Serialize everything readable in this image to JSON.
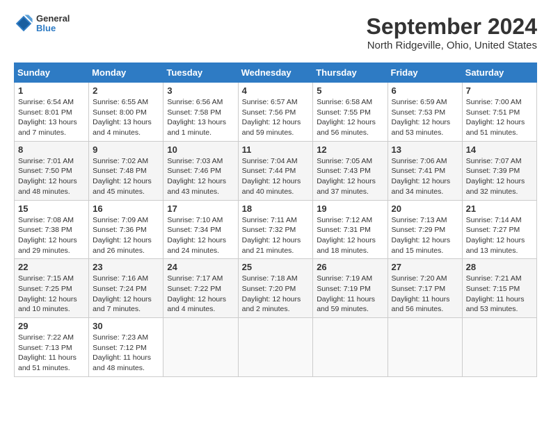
{
  "app": {
    "logo_line1": "General",
    "logo_line2": "Blue"
  },
  "header": {
    "title": "September 2024",
    "subtitle": "North Ridgeville, Ohio, United States"
  },
  "calendar": {
    "days_of_week": [
      "Sunday",
      "Monday",
      "Tuesday",
      "Wednesday",
      "Thursday",
      "Friday",
      "Saturday"
    ],
    "weeks": [
      [
        {
          "day": 1,
          "info": "Sunrise: 6:54 AM\nSunset: 8:01 PM\nDaylight: 13 hours and 7 minutes."
        },
        {
          "day": 2,
          "info": "Sunrise: 6:55 AM\nSunset: 8:00 PM\nDaylight: 13 hours and 4 minutes."
        },
        {
          "day": 3,
          "info": "Sunrise: 6:56 AM\nSunset: 7:58 PM\nDaylight: 13 hours and 1 minute."
        },
        {
          "day": 4,
          "info": "Sunrise: 6:57 AM\nSunset: 7:56 PM\nDaylight: 12 hours and 59 minutes."
        },
        {
          "day": 5,
          "info": "Sunrise: 6:58 AM\nSunset: 7:55 PM\nDaylight: 12 hours and 56 minutes."
        },
        {
          "day": 6,
          "info": "Sunrise: 6:59 AM\nSunset: 7:53 PM\nDaylight: 12 hours and 53 minutes."
        },
        {
          "day": 7,
          "info": "Sunrise: 7:00 AM\nSunset: 7:51 PM\nDaylight: 12 hours and 51 minutes."
        }
      ],
      [
        {
          "day": 8,
          "info": "Sunrise: 7:01 AM\nSunset: 7:50 PM\nDaylight: 12 hours and 48 minutes."
        },
        {
          "day": 9,
          "info": "Sunrise: 7:02 AM\nSunset: 7:48 PM\nDaylight: 12 hours and 45 minutes."
        },
        {
          "day": 10,
          "info": "Sunrise: 7:03 AM\nSunset: 7:46 PM\nDaylight: 12 hours and 43 minutes."
        },
        {
          "day": 11,
          "info": "Sunrise: 7:04 AM\nSunset: 7:44 PM\nDaylight: 12 hours and 40 minutes."
        },
        {
          "day": 12,
          "info": "Sunrise: 7:05 AM\nSunset: 7:43 PM\nDaylight: 12 hours and 37 minutes."
        },
        {
          "day": 13,
          "info": "Sunrise: 7:06 AM\nSunset: 7:41 PM\nDaylight: 12 hours and 34 minutes."
        },
        {
          "day": 14,
          "info": "Sunrise: 7:07 AM\nSunset: 7:39 PM\nDaylight: 12 hours and 32 minutes."
        }
      ],
      [
        {
          "day": 15,
          "info": "Sunrise: 7:08 AM\nSunset: 7:38 PM\nDaylight: 12 hours and 29 minutes."
        },
        {
          "day": 16,
          "info": "Sunrise: 7:09 AM\nSunset: 7:36 PM\nDaylight: 12 hours and 26 minutes."
        },
        {
          "day": 17,
          "info": "Sunrise: 7:10 AM\nSunset: 7:34 PM\nDaylight: 12 hours and 24 minutes."
        },
        {
          "day": 18,
          "info": "Sunrise: 7:11 AM\nSunset: 7:32 PM\nDaylight: 12 hours and 21 minutes."
        },
        {
          "day": 19,
          "info": "Sunrise: 7:12 AM\nSunset: 7:31 PM\nDaylight: 12 hours and 18 minutes."
        },
        {
          "day": 20,
          "info": "Sunrise: 7:13 AM\nSunset: 7:29 PM\nDaylight: 12 hours and 15 minutes."
        },
        {
          "day": 21,
          "info": "Sunrise: 7:14 AM\nSunset: 7:27 PM\nDaylight: 12 hours and 13 minutes."
        }
      ],
      [
        {
          "day": 22,
          "info": "Sunrise: 7:15 AM\nSunset: 7:25 PM\nDaylight: 12 hours and 10 minutes."
        },
        {
          "day": 23,
          "info": "Sunrise: 7:16 AM\nSunset: 7:24 PM\nDaylight: 12 hours and 7 minutes."
        },
        {
          "day": 24,
          "info": "Sunrise: 7:17 AM\nSunset: 7:22 PM\nDaylight: 12 hours and 4 minutes."
        },
        {
          "day": 25,
          "info": "Sunrise: 7:18 AM\nSunset: 7:20 PM\nDaylight: 12 hours and 2 minutes."
        },
        {
          "day": 26,
          "info": "Sunrise: 7:19 AM\nSunset: 7:19 PM\nDaylight: 11 hours and 59 minutes."
        },
        {
          "day": 27,
          "info": "Sunrise: 7:20 AM\nSunset: 7:17 PM\nDaylight: 11 hours and 56 minutes."
        },
        {
          "day": 28,
          "info": "Sunrise: 7:21 AM\nSunset: 7:15 PM\nDaylight: 11 hours and 53 minutes."
        }
      ],
      [
        {
          "day": 29,
          "info": "Sunrise: 7:22 AM\nSunset: 7:13 PM\nDaylight: 11 hours and 51 minutes."
        },
        {
          "day": 30,
          "info": "Sunrise: 7:23 AM\nSunset: 7:12 PM\nDaylight: 11 hours and 48 minutes."
        },
        null,
        null,
        null,
        null,
        null
      ]
    ]
  }
}
